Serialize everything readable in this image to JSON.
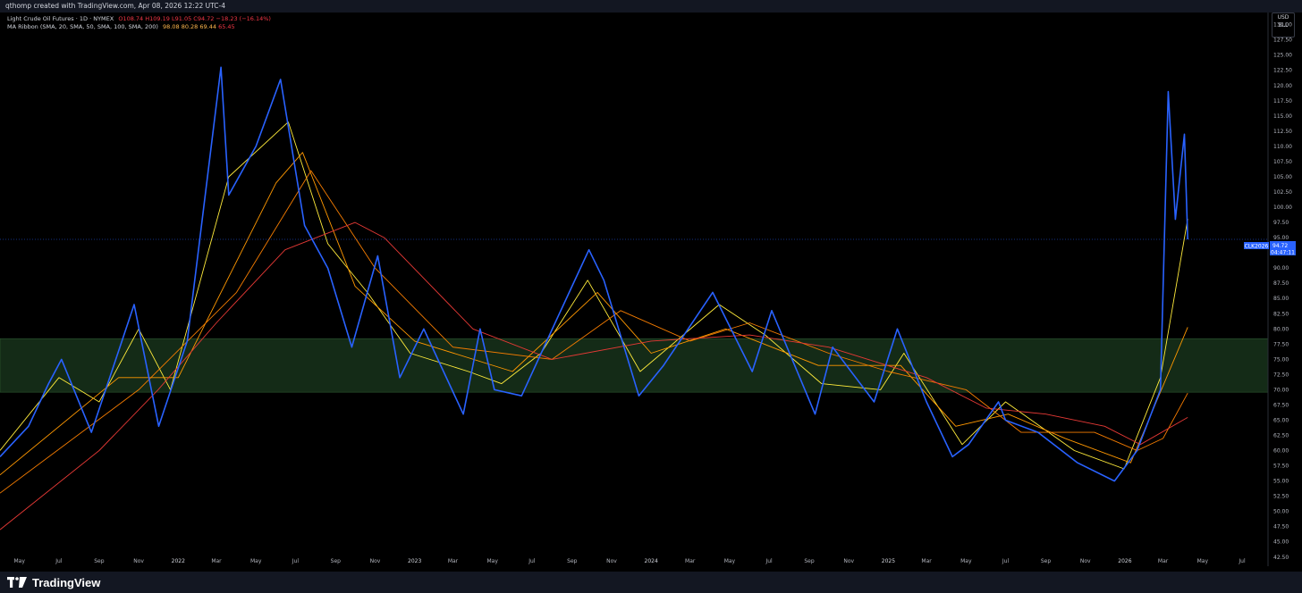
{
  "header": {
    "credit": "qthomp created with TradingView.com, Apr 08, 2026 12:22 UTC-4"
  },
  "legend": {
    "symbol": "Light Crude Oil Futures · 1D · NYMEX",
    "open": "O108.74",
    "high": "H109.19",
    "low": "L91.05",
    "close": "C94.72",
    "change": "−18.23 (−16.14%)",
    "ribbon_label": "MA Ribbon (SMA, 20, SMA, 50, SMA, 100, SMA, 200)",
    "ribbon_values": [
      "98.08",
      "80.28",
      "69.44",
      "65.45"
    ]
  },
  "price_axis": {
    "unit_top": "USD",
    "unit_bottom": "BLL",
    "ticks": [
      "130.00",
      "127.50",
      "125.00",
      "122.50",
      "120.00",
      "117.50",
      "115.00",
      "112.50",
      "110.00",
      "107.50",
      "105.00",
      "102.50",
      "100.00",
      "97.50",
      "95.00",
      "92.50",
      "90.00",
      "87.50",
      "85.00",
      "82.50",
      "80.00",
      "77.50",
      "75.00",
      "72.50",
      "70.00",
      "67.50",
      "65.00",
      "62.50",
      "60.00",
      "57.50",
      "55.00",
      "52.50",
      "50.00",
      "47.50",
      "45.00",
      "42.50"
    ]
  },
  "last_price": {
    "symbol": "CLK2026",
    "price": "94.72",
    "countdown": "04:47:11"
  },
  "time_axis": {
    "labels": [
      "May",
      "Jul",
      "Sep",
      "Nov",
      "2022",
      "Mar",
      "May",
      "Jul",
      "Sep",
      "Nov",
      "2023",
      "Mar",
      "May",
      "Jul",
      "Sep",
      "Nov",
      "2024",
      "Mar",
      "May",
      "Jul",
      "Sep",
      "Nov",
      "2025",
      "Mar",
      "May",
      "Jul",
      "Sep",
      "Nov",
      "2026",
      "Mar",
      "May",
      "Jul"
    ]
  },
  "footer": {
    "brand": "TradingView"
  },
  "colors": {
    "candles": "#2962ff",
    "sma20": "#ffeb3b",
    "sma50": "#ff9800",
    "sma100": "#f57c00",
    "sma200": "#e53935",
    "zone": "#1b3a1f"
  },
  "chart_data": {
    "type": "line",
    "title": "Light Crude Oil Futures · 1D · NYMEX",
    "ylim": [
      41,
      132
    ],
    "x_start": "2021-04-01",
    "x_end": "2026-08-10",
    "zone": [
      69.6,
      78.4
    ],
    "series": [
      {
        "name": "Light Crude Oil Futures",
        "dates": [
          "2021-04-01",
          "2021-05-15",
          "2021-06-15",
          "2021-07-05",
          "2021-08-20",
          "2021-10-25",
          "2021-12-02",
          "2022-01-15",
          "2022-03-08",
          "2022-03-20",
          "2022-05-01",
          "2022-06-08",
          "2022-07-15",
          "2022-08-20",
          "2022-09-26",
          "2022-11-05",
          "2022-12-09",
          "2023-01-15",
          "2023-03-17",
          "2023-04-12",
          "2023-05-04",
          "2023-06-15",
          "2023-08-10",
          "2023-09-27",
          "2023-10-20",
          "2023-12-13",
          "2024-01-20",
          "2024-04-05",
          "2024-06-05",
          "2024-07-05",
          "2024-09-10",
          "2024-10-07",
          "2024-12-10",
          "2025-01-15",
          "2025-03-01",
          "2025-04-10",
          "2025-05-05",
          "2025-06-20",
          "2025-07-01",
          "2025-08-20",
          "2025-10-20",
          "2025-12-16",
          "2026-01-20",
          "2026-02-25",
          "2026-03-09",
          "2026-03-20",
          "2026-04-03",
          "2026-04-08"
        ],
        "values": [
          59,
          64,
          71,
          75,
          63,
          84,
          64,
          78,
          123,
          102,
          110,
          121,
          97,
          90,
          77,
          92,
          72,
          80,
          66,
          80,
          70,
          69,
          82,
          93,
          88,
          69,
          74,
          86,
          73,
          83,
          66,
          77,
          68,
          80,
          68,
          59,
          61,
          68,
          65,
          63,
          58,
          55,
          60,
          70,
          119,
          98,
          112,
          94.72
        ]
      },
      {
        "name": "SMA 20",
        "dates": [
          "2021-04-01",
          "2021-07-01",
          "2021-09-01",
          "2021-11-01",
          "2021-12-20",
          "2022-03-20",
          "2022-06-20",
          "2022-08-20",
          "2022-10-20",
          "2022-12-25",
          "2023-03-25",
          "2023-05-15",
          "2023-07-15",
          "2023-09-25",
          "2023-12-15",
          "2024-04-15",
          "2024-06-25",
          "2024-09-20",
          "2024-12-20",
          "2025-01-25",
          "2025-04-25",
          "2025-07-01",
          "2025-10-15",
          "2025-12-31",
          "2026-02-25",
          "2026-04-08"
        ],
        "values": [
          60,
          72,
          68,
          80,
          70,
          105,
          114,
          94,
          86,
          76,
          73,
          71,
          76,
          88,
          73,
          84,
          79,
          71,
          70,
          76,
          61,
          68,
          60,
          57,
          72,
          98.08
        ]
      },
      {
        "name": "SMA 50",
        "dates": [
          "2021-04-01",
          "2021-10-01",
          "2022-01-01",
          "2022-06-01",
          "2022-07-12",
          "2022-10-01",
          "2023-01-01",
          "2023-06-01",
          "2023-10-10",
          "2024-01-01",
          "2024-04-25",
          "2024-09-15",
          "2025-01-20",
          "2025-04-15",
          "2025-07-05",
          "2025-10-01",
          "2026-01-10",
          "2026-04-08"
        ],
        "values": [
          56,
          72,
          72,
          104,
          109,
          87,
          78,
          73,
          86,
          76,
          80,
          74,
          74,
          64,
          66,
          62,
          58,
          80.28
        ]
      },
      {
        "name": "SMA 100",
        "dates": [
          "2021-04-01",
          "2021-11-01",
          "2022-04-01",
          "2022-07-25",
          "2022-11-01",
          "2023-03-01",
          "2023-08-01",
          "2023-11-15",
          "2024-03-01",
          "2024-06-01",
          "2024-10-01",
          "2025-01-01",
          "2025-05-01",
          "2025-07-25",
          "2025-11-15",
          "2026-01-20",
          "2026-03-01",
          "2026-04-08"
        ],
        "values": [
          53,
          70,
          86,
          106,
          90,
          77,
          75,
          83,
          78,
          81,
          76,
          73,
          70,
          63,
          63,
          60,
          62,
          69.44
        ]
      },
      {
        "name": "SMA 200",
        "dates": [
          "2021-04-01",
          "2021-09-01",
          "2021-12-01",
          "2022-03-01",
          "2022-06-15",
          "2022-10-01",
          "2022-11-15",
          "2023-04-01",
          "2023-08-01",
          "2024-01-01",
          "2024-06-01",
          "2024-10-01",
          "2025-03-01",
          "2025-06-01",
          "2025-09-01",
          "2025-12-01",
          "2026-01-25",
          "2026-04-08"
        ],
        "values": [
          47,
          60,
          70,
          81,
          93,
          97.5,
          95,
          80,
          75,
          78,
          79,
          77,
          72,
          67,
          66,
          64,
          61,
          65.45
        ]
      }
    ]
  }
}
